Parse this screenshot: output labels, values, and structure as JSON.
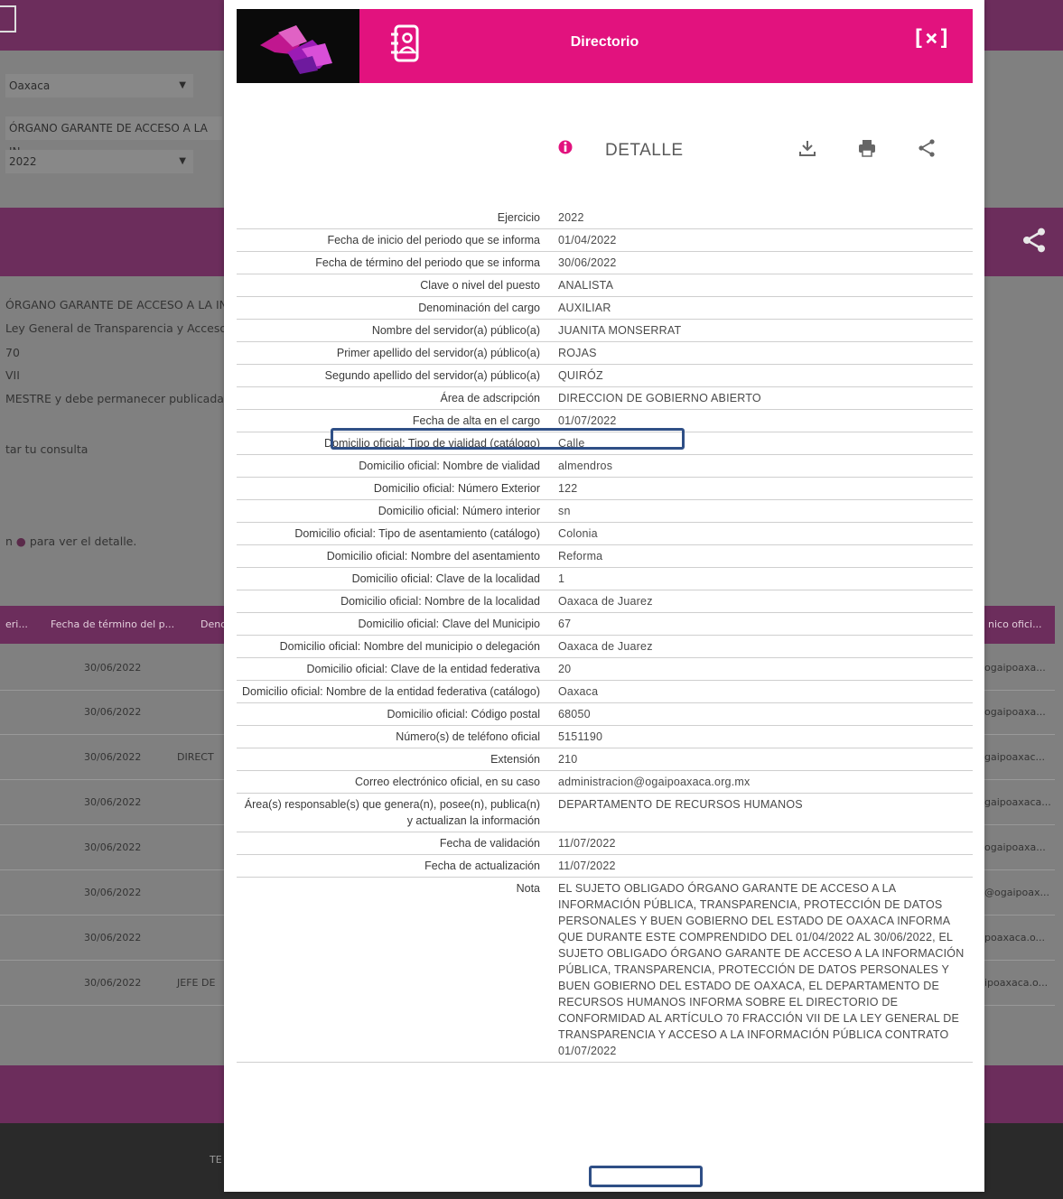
{
  "background": {
    "state_select": "Oaxaca",
    "org_select": "ÓRGANO GARANTE DE ACCESO A LA IN",
    "year_select": "2022",
    "info_lines": [
      "ÓRGANO GARANTE DE ACCESO A LA IN",
      "Ley General de Transparencia y Acceso",
      "70",
      "VII",
      "MESTRE y debe permanecer publicada, d"
    ],
    "consulta_text": "tar tu consulta",
    "detalle_hint_prefix": "n",
    "detalle_hint_suffix": "para ver el detalle.",
    "table_headers": [
      "eri...",
      "Fecha de término del p...",
      "Deno",
      "nico ofici..."
    ],
    "rows": [
      {
        "date": "30/06/2022",
        "mid": "",
        "email": "ogaipoaxa..."
      },
      {
        "date": "30/06/2022",
        "mid": "",
        "email": "ogaipoaxa..."
      },
      {
        "date": "30/06/2022",
        "mid": "DIRECT",
        "email": "gaipoaxac..."
      },
      {
        "date": "30/06/2022",
        "mid": "",
        "email": "gaipoaxaca..."
      },
      {
        "date": "30/06/2022",
        "mid": "",
        "email": "ogaipoaxa..."
      },
      {
        "date": "30/06/2022",
        "mid": "",
        "email": "@ogaipoax..."
      },
      {
        "date": "30/06/2022",
        "mid": "",
        "email": "poaxaca.o..."
      },
      {
        "date": "30/06/2022",
        "mid": "JEFE DE",
        "email": "ipoaxaca.o..."
      }
    ],
    "footer_text": "TE"
  },
  "modal": {
    "title": "Directorio",
    "close_label": "[×]",
    "detail_label": "DETALLE",
    "icons": [
      "download-icon",
      "print-icon",
      "share-icon"
    ],
    "accent_color": "#e2127e",
    "highlight_color": "#2f4f86"
  },
  "details": [
    {
      "label": "Ejercicio",
      "value": "2022"
    },
    {
      "label": "Fecha de inicio del periodo que se informa",
      "value": "01/04/2022"
    },
    {
      "label": "Fecha de término del periodo que se informa",
      "value": "30/06/2022"
    },
    {
      "label": "Clave o nivel del puesto",
      "value": "ANALISTA"
    },
    {
      "label": "Denominación del cargo",
      "value": "AUXILIAR"
    },
    {
      "label": "Nombre del servidor(a) público(a)",
      "value": "JUANITA MONSERRAT"
    },
    {
      "label": "Primer apellido del servidor(a) público(a)",
      "value": "ROJAS"
    },
    {
      "label": "Segundo apellido del servidor(a) público(a)",
      "value": "QUIRÓZ"
    },
    {
      "label": "Área de adscripción",
      "value": "DIRECCION DE GOBIERNO ABIERTO"
    },
    {
      "label": "Fecha de alta en el cargo",
      "value": "01/07/2022"
    },
    {
      "label": "Domicilio oficial: Tipo de vialidad (catálogo)",
      "value": "Calle"
    },
    {
      "label": "Domicilio oficial: Nombre de vialidad",
      "value": "almendros"
    },
    {
      "label": "Domicilio oficial: Número Exterior",
      "value": "122"
    },
    {
      "label": "Domicilio oficial: Número interior",
      "value": "sn"
    },
    {
      "label": "Domicilio oficial: Tipo de asentamiento (catálogo)",
      "value": "Colonia"
    },
    {
      "label": "Domicilio oficial: Nombre del asentamiento",
      "value": "Reforma"
    },
    {
      "label": "Domicilio oficial: Clave de la localidad",
      "value": "1"
    },
    {
      "label": "Domicilio oficial: Nombre de la localidad",
      "value": "Oaxaca de Juarez"
    },
    {
      "label": "Domicilio oficial: Clave del Municipio",
      "value": "67"
    },
    {
      "label": "Domicilio oficial: Nombre del municipio o delegación",
      "value": "Oaxaca de Juarez"
    },
    {
      "label": "Domicilio oficial: Clave de la entidad federativa",
      "value": "20"
    },
    {
      "label": "Domicilio oficial: Nombre de la entidad federativa (catálogo)",
      "value": "Oaxaca"
    },
    {
      "label": "Domicilio oficial: Código postal",
      "value": "68050"
    },
    {
      "label": "Número(s) de teléfono oficial",
      "value": "5151190"
    },
    {
      "label": "Extensión",
      "value": "210"
    },
    {
      "label": "Correo electrónico oficial, en su caso",
      "value": "administracion@ogaipoaxaca.org.mx"
    },
    {
      "label": "Área(s) responsable(s) que genera(n), posee(n), publica(n) y actualizan la información",
      "value": "DEPARTAMENTO DE RECURSOS HUMANOS"
    },
    {
      "label": "Fecha de validación",
      "value": "11/07/2022"
    },
    {
      "label": "Fecha de actualización",
      "value": "11/07/2022"
    },
    {
      "label": "Nota",
      "value": "EL SUJETO OBLIGADO ÓRGANO GARANTE DE ACCESO A LA INFORMACIÓN PÚBLICA, TRANSPARENCIA, PROTECCIÓN DE DATOS PERSONALES Y BUEN GOBIERNO DEL ESTADO DE OAXACA INFORMA QUE DURANTE ESTE COMPRENDIDO DEL 01/04/2022 AL 30/06/2022, EL SUJETO OBLIGADO ÓRGANO GARANTE DE ACCESO A LA INFORMACIÓN PÚBLICA, TRANSPARENCIA, PROTECCIÓN DE DATOS PERSONALES Y BUEN GOBIERNO DEL ESTADO DE OAXACA, EL DEPARTAMENTO DE RECURSOS HUMANOS INFORMA SOBRE EL DIRECTORIO DE CONFORMIDAD AL ARTÍCULO 70 FRACCIÓN VII DE LA LEY GENERAL DE TRANSPARENCIA Y ACCESO A LA INFORMACIÓN PÚBLICA CONTRATO 01/07/2022"
    }
  ]
}
